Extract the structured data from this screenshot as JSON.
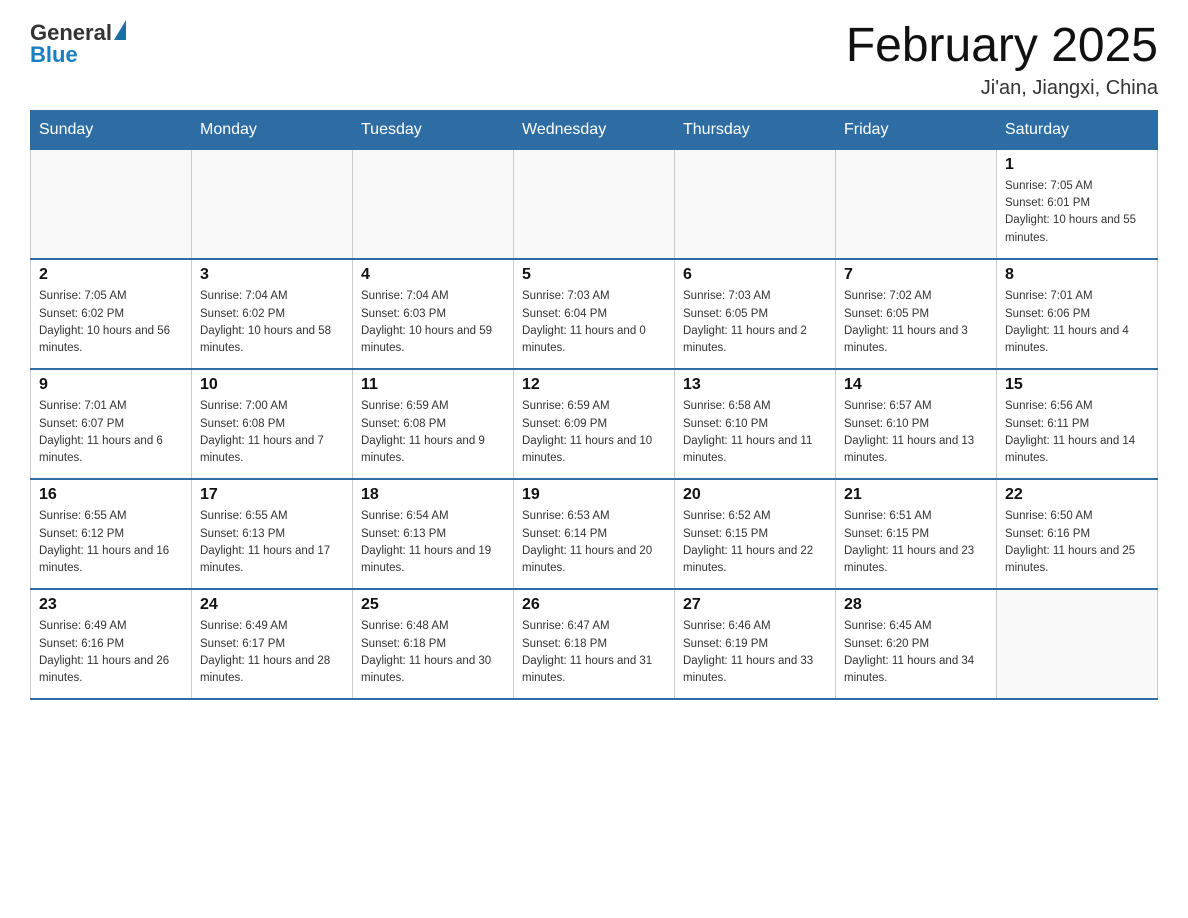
{
  "header": {
    "logo_general": "General",
    "logo_blue": "Blue",
    "month_title": "February 2025",
    "location": "Ji'an, Jiangxi, China"
  },
  "days_of_week": [
    "Sunday",
    "Monday",
    "Tuesday",
    "Wednesday",
    "Thursday",
    "Friday",
    "Saturday"
  ],
  "weeks": [
    [
      {
        "day": "",
        "info": ""
      },
      {
        "day": "",
        "info": ""
      },
      {
        "day": "",
        "info": ""
      },
      {
        "day": "",
        "info": ""
      },
      {
        "day": "",
        "info": ""
      },
      {
        "day": "",
        "info": ""
      },
      {
        "day": "1",
        "info": "Sunrise: 7:05 AM\nSunset: 6:01 PM\nDaylight: 10 hours and 55 minutes."
      }
    ],
    [
      {
        "day": "2",
        "info": "Sunrise: 7:05 AM\nSunset: 6:02 PM\nDaylight: 10 hours and 56 minutes."
      },
      {
        "day": "3",
        "info": "Sunrise: 7:04 AM\nSunset: 6:02 PM\nDaylight: 10 hours and 58 minutes."
      },
      {
        "day": "4",
        "info": "Sunrise: 7:04 AM\nSunset: 6:03 PM\nDaylight: 10 hours and 59 minutes."
      },
      {
        "day": "5",
        "info": "Sunrise: 7:03 AM\nSunset: 6:04 PM\nDaylight: 11 hours and 0 minutes."
      },
      {
        "day": "6",
        "info": "Sunrise: 7:03 AM\nSunset: 6:05 PM\nDaylight: 11 hours and 2 minutes."
      },
      {
        "day": "7",
        "info": "Sunrise: 7:02 AM\nSunset: 6:05 PM\nDaylight: 11 hours and 3 minutes."
      },
      {
        "day": "8",
        "info": "Sunrise: 7:01 AM\nSunset: 6:06 PM\nDaylight: 11 hours and 4 minutes."
      }
    ],
    [
      {
        "day": "9",
        "info": "Sunrise: 7:01 AM\nSunset: 6:07 PM\nDaylight: 11 hours and 6 minutes."
      },
      {
        "day": "10",
        "info": "Sunrise: 7:00 AM\nSunset: 6:08 PM\nDaylight: 11 hours and 7 minutes."
      },
      {
        "day": "11",
        "info": "Sunrise: 6:59 AM\nSunset: 6:08 PM\nDaylight: 11 hours and 9 minutes."
      },
      {
        "day": "12",
        "info": "Sunrise: 6:59 AM\nSunset: 6:09 PM\nDaylight: 11 hours and 10 minutes."
      },
      {
        "day": "13",
        "info": "Sunrise: 6:58 AM\nSunset: 6:10 PM\nDaylight: 11 hours and 11 minutes."
      },
      {
        "day": "14",
        "info": "Sunrise: 6:57 AM\nSunset: 6:10 PM\nDaylight: 11 hours and 13 minutes."
      },
      {
        "day": "15",
        "info": "Sunrise: 6:56 AM\nSunset: 6:11 PM\nDaylight: 11 hours and 14 minutes."
      }
    ],
    [
      {
        "day": "16",
        "info": "Sunrise: 6:55 AM\nSunset: 6:12 PM\nDaylight: 11 hours and 16 minutes."
      },
      {
        "day": "17",
        "info": "Sunrise: 6:55 AM\nSunset: 6:13 PM\nDaylight: 11 hours and 17 minutes."
      },
      {
        "day": "18",
        "info": "Sunrise: 6:54 AM\nSunset: 6:13 PM\nDaylight: 11 hours and 19 minutes."
      },
      {
        "day": "19",
        "info": "Sunrise: 6:53 AM\nSunset: 6:14 PM\nDaylight: 11 hours and 20 minutes."
      },
      {
        "day": "20",
        "info": "Sunrise: 6:52 AM\nSunset: 6:15 PM\nDaylight: 11 hours and 22 minutes."
      },
      {
        "day": "21",
        "info": "Sunrise: 6:51 AM\nSunset: 6:15 PM\nDaylight: 11 hours and 23 minutes."
      },
      {
        "day": "22",
        "info": "Sunrise: 6:50 AM\nSunset: 6:16 PM\nDaylight: 11 hours and 25 minutes."
      }
    ],
    [
      {
        "day": "23",
        "info": "Sunrise: 6:49 AM\nSunset: 6:16 PM\nDaylight: 11 hours and 26 minutes."
      },
      {
        "day": "24",
        "info": "Sunrise: 6:49 AM\nSunset: 6:17 PM\nDaylight: 11 hours and 28 minutes."
      },
      {
        "day": "25",
        "info": "Sunrise: 6:48 AM\nSunset: 6:18 PM\nDaylight: 11 hours and 30 minutes."
      },
      {
        "day": "26",
        "info": "Sunrise: 6:47 AM\nSunset: 6:18 PM\nDaylight: 11 hours and 31 minutes."
      },
      {
        "day": "27",
        "info": "Sunrise: 6:46 AM\nSunset: 6:19 PM\nDaylight: 11 hours and 33 minutes."
      },
      {
        "day": "28",
        "info": "Sunrise: 6:45 AM\nSunset: 6:20 PM\nDaylight: 11 hours and 34 minutes."
      },
      {
        "day": "",
        "info": ""
      }
    ]
  ]
}
